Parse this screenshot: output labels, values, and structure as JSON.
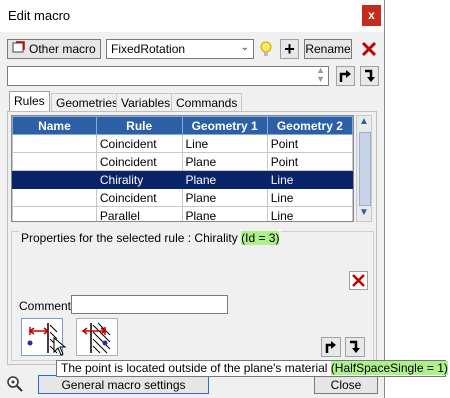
{
  "window": {
    "title": "Edit macro",
    "close_glyph": "x"
  },
  "toolbar": {
    "other_macro_label": "Other macro",
    "macro_selected": "FixedRotation",
    "rename_label": "Rename",
    "add_glyph": "+"
  },
  "tabs": [
    {
      "label": "Rules",
      "active": true
    },
    {
      "label": "Geometries",
      "active": false
    },
    {
      "label": "Variables",
      "active": false
    },
    {
      "label": "Commands",
      "active": false
    }
  ],
  "grid": {
    "columns": [
      "Name",
      "Rule",
      "Geometry 1",
      "Geometry 2"
    ],
    "rows": [
      [
        "",
        "Coincident",
        "Line",
        "Point"
      ],
      [
        "",
        "Coincident",
        "Plane",
        "Point"
      ],
      [
        "",
        "Chirality",
        "Plane",
        "Line"
      ],
      [
        "",
        "Coincident",
        "Plane",
        "Line"
      ],
      [
        "",
        "Parallel",
        "Plane",
        "Line"
      ]
    ],
    "selected_row": 2
  },
  "properties": {
    "label_prefix": "Properties for the selected rule : Chirality",
    "id_badge": "(Id = 3)",
    "comment_label": "Comment",
    "comment_value": ""
  },
  "tooltip": {
    "text": "The point is located outside of the plane's material",
    "badge": "(HalfSpaceSingle = 1)"
  },
  "footer": {
    "general_settings_label": "General macro settings",
    "close_label": "Close"
  },
  "colors": {
    "header_blue": "#2b5fa6",
    "selection": "#0a246a",
    "highlight_green": "#aef08a",
    "close_red": "#c42b1c"
  }
}
